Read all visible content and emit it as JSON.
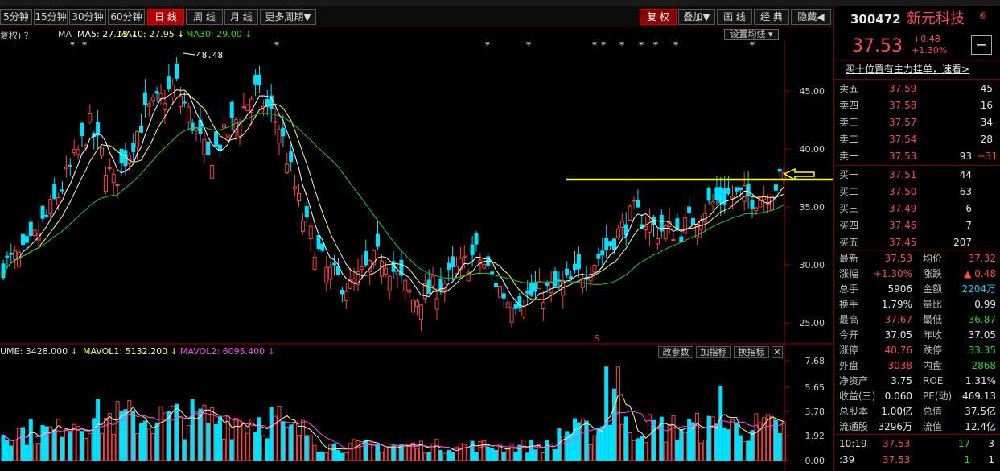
{
  "toolbar": {
    "periods": [
      "5分钟",
      "15分钟",
      "30分钟",
      "60分钟",
      "日 线",
      "周 线",
      "月 线",
      "更多周期▼"
    ],
    "active_period": "日 线",
    "right_buttons": [
      "复 权",
      "叠加▼",
      "画 线",
      "经 典",
      "隐藏◀"
    ]
  },
  "legend": {
    "prefix": "复权) ？",
    "ma_label": "MA",
    "ma5": "MA5: 27.13 ↓",
    "ma10": "MA10: 27.95 ↓",
    "ma30": "MA30: 29.00 ↓",
    "setting_button": "设置均线 ▾"
  },
  "kline": {
    "y_ticks": [
      "45.00",
      "40.00",
      "35.00",
      "30.00",
      "25.00"
    ],
    "high_marker": "48.48",
    "colors": {
      "up": "#ff4040",
      "down": "#00e0ff",
      "ma5": "#ffffff",
      "ma10": "#ffff80",
      "ma30": "#22c822",
      "annot": "#ffff00"
    }
  },
  "volume": {
    "label": "UME: 3428.000 ↓",
    "mavol1": "MAVOL1: 5132.200 ↓",
    "mavol2": "MAVOL2: 6095.400 ↓",
    "buttons": [
      "改参数",
      "加指标",
      "换指标",
      "✕"
    ],
    "y_ticks": [
      "7.68",
      "5.65",
      "3.78",
      "1.92",
      "0.00"
    ]
  },
  "quote": {
    "code": "300472",
    "name": "新元科技",
    "name_mark": "⑥",
    "price": "37.53",
    "change": "+0.48",
    "change_pct": "+1.30%",
    "minus_button": "−",
    "banner": "买十位置有主力挂单，速看>",
    "sell": [
      {
        "label": "卖五",
        "price": "37.59",
        "vol": "45",
        "delta": ""
      },
      {
        "label": "卖四",
        "price": "37.58",
        "vol": "16",
        "delta": ""
      },
      {
        "label": "卖三",
        "price": "37.57",
        "vol": "34",
        "delta": ""
      },
      {
        "label": "卖二",
        "price": "37.54",
        "vol": "28",
        "delta": ""
      },
      {
        "label": "卖一",
        "price": "37.53",
        "vol": "93",
        "delta": "+31"
      }
    ],
    "buy": [
      {
        "label": "买一",
        "price": "37.51",
        "vol": "44"
      },
      {
        "label": "买二",
        "price": "37.50",
        "vol": "63"
      },
      {
        "label": "买三",
        "price": "37.49",
        "vol": "6"
      },
      {
        "label": "买四",
        "price": "37.46",
        "vol": "7"
      },
      {
        "label": "买五",
        "price": "37.45",
        "vol": "207"
      }
    ],
    "stats": [
      {
        "l1": "最新",
        "v1": "37.53",
        "c1": "red",
        "l2": "均价",
        "v2": "37.32",
        "c2": "red"
      },
      {
        "l1": "涨幅",
        "v1": "+1.30%",
        "c1": "red",
        "l2": "涨跌",
        "v2": "▲ 0.48",
        "c2": "red"
      },
      {
        "l1": "总手",
        "v1": "5906",
        "c1": "white",
        "l2": "金额",
        "v2": "2204万",
        "c2": "cyan"
      },
      {
        "l1": "换手",
        "v1": "1.79%",
        "c1": "white",
        "l2": "量比",
        "v2": "0.99",
        "c2": "white"
      },
      {
        "l1": "最高",
        "v1": "37.67",
        "c1": "red",
        "l2": "最低",
        "v2": "36.87",
        "c2": "green"
      },
      {
        "l1": "今开",
        "v1": "37.05",
        "c1": "white",
        "l2": "昨收",
        "v2": "37.05",
        "c2": "white"
      },
      {
        "l1": "涨停",
        "v1": "40.76",
        "c1": "red",
        "l2": "跌停",
        "v2": "33.35",
        "c2": "green"
      },
      {
        "l1": "外盘",
        "v1": "3038",
        "c1": "red",
        "l2": "内盘",
        "v2": "2868",
        "c2": "green"
      },
      {
        "l1": "净资产",
        "v1": "3.75",
        "c1": "white",
        "l2": "ROE",
        "v2": "1.31%",
        "c2": "white"
      },
      {
        "l1": "收益(三)",
        "v1": "0.060",
        "c1": "white",
        "l2": "PE(动)",
        "v2": "469.13",
        "c2": "white"
      },
      {
        "l1": "总股本",
        "v1": "1.00亿",
        "c1": "white",
        "l2": "总值",
        "v2": "37.5亿",
        "c2": "white"
      },
      {
        "l1": "流通股",
        "v1": "3296万",
        "c1": "white",
        "l2": "流值",
        "v2": "12.4亿",
        "c2": "white"
      }
    ],
    "ticks": [
      {
        "time": "10:19",
        "price": "37.53",
        "vol": "17",
        "n": "3"
      },
      {
        "time": ":39",
        "price": "37.53",
        "vol": "1",
        "n": "1"
      }
    ]
  }
}
